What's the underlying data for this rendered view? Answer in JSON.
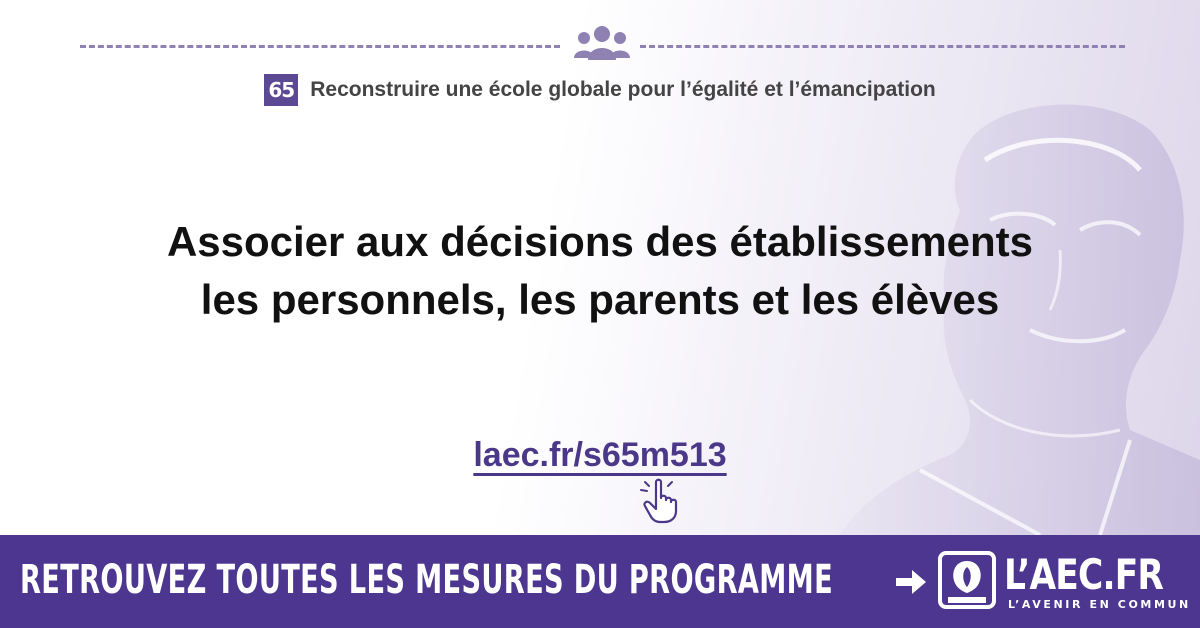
{
  "chapter": {
    "number": "65",
    "title": "Reconstruire une école globale pour l’égalité et l’émancipation"
  },
  "headline": {
    "line1": "Associer aux décisions des établissements",
    "line2": "les personnels, les parents et les élèves"
  },
  "link": {
    "text": "laec.fr/s65m513"
  },
  "banner": {
    "text": "RETROUVEZ TOUTES LES MESURES DU PROGRAMME"
  },
  "logo": {
    "name": "L’AEC.FR",
    "tagline": "L’AVENIR EN COMMUN"
  },
  "icons": [
    "people-icon",
    "hand-pointer-icon",
    "arrow-right-icon",
    "laec-logo-mark",
    "portrait-silhouette"
  ],
  "colors": {
    "brand_purple": "#4c3690",
    "link_purple": "#4b3888",
    "badge_purple": "#5b4a93",
    "text_dark": "#111111",
    "rule": "#8f82b3"
  }
}
